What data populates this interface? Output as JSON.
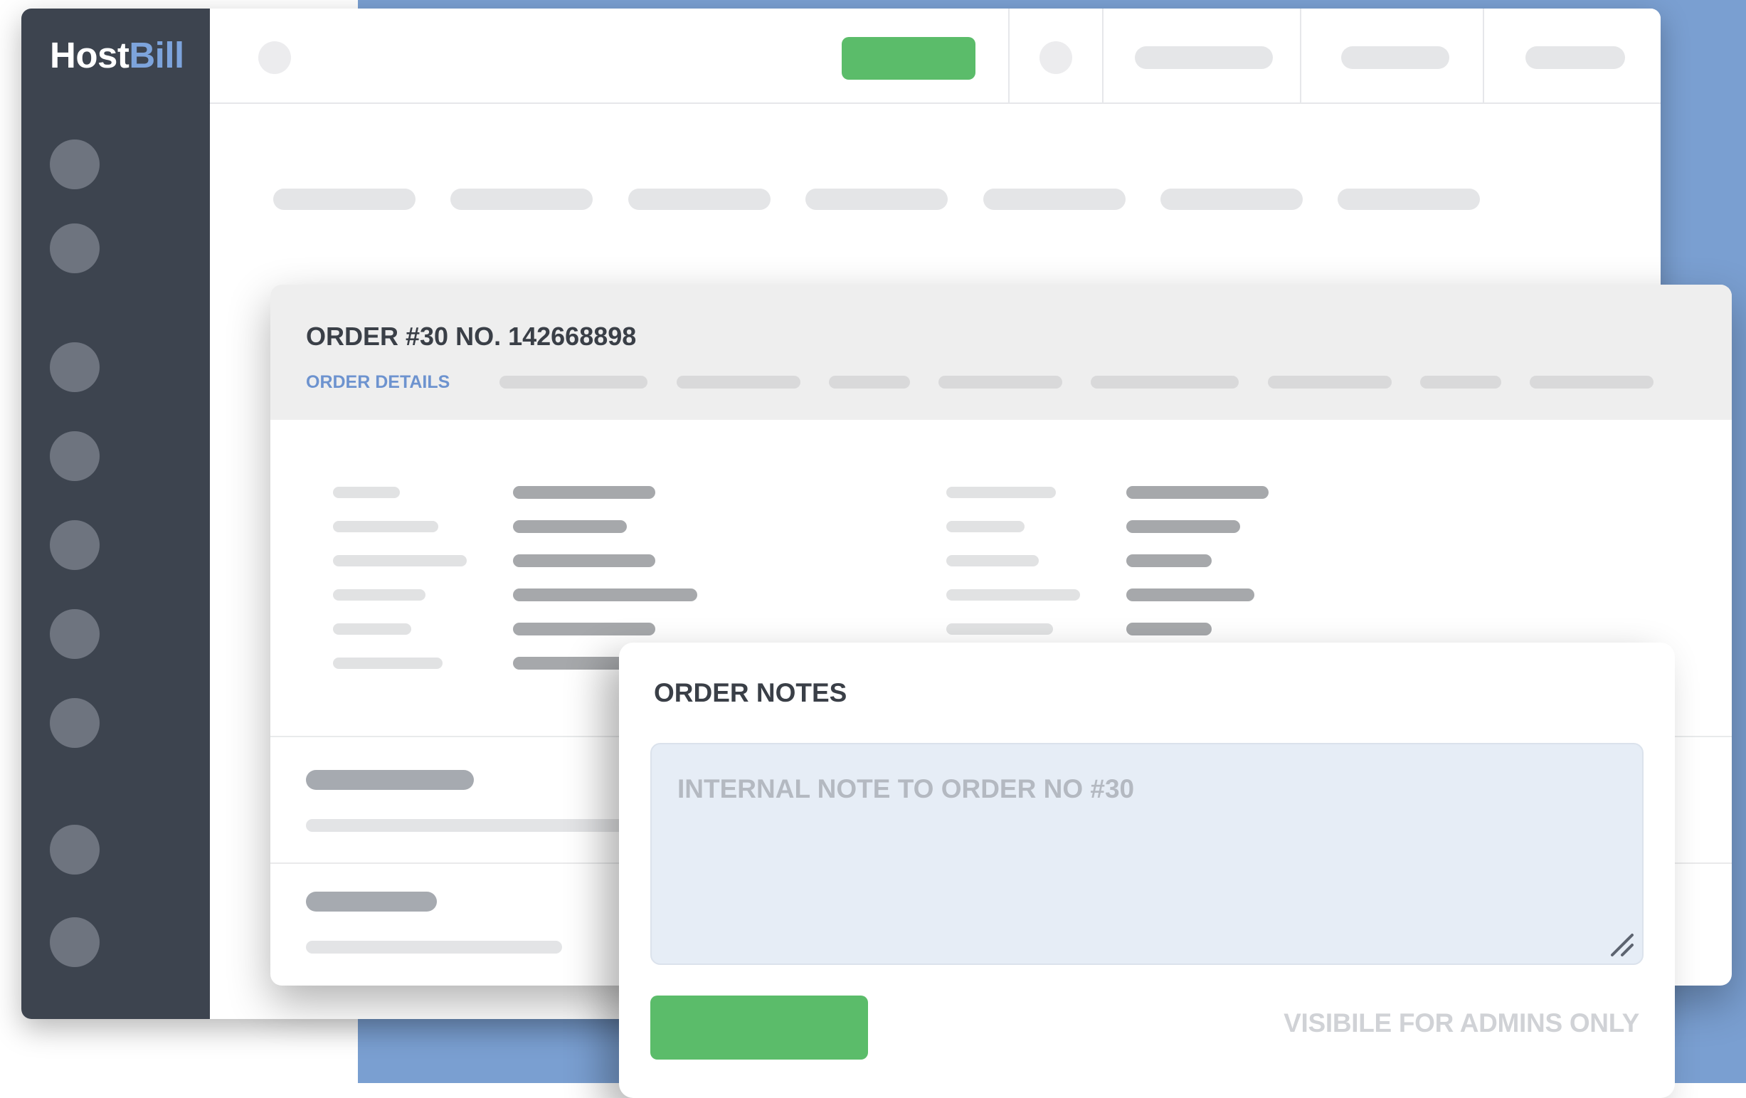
{
  "app": {
    "logo_part1": "Host",
    "logo_part2": "Bill"
  },
  "colors": {
    "accent_green": "#5bbc6a",
    "brand_blue": "#7da4dc",
    "sidebar": "#3d444f",
    "backdrop_blue": "#7a9fd1"
  },
  "order_panel": {
    "title": "ORDER #30 NO. 142668898",
    "active_tab": "ORDER DETAILS"
  },
  "notes_modal": {
    "title": "ORDER NOTES",
    "textarea_placeholder": "INTERNAL NOTE TO ORDER NO #30",
    "textarea_value": "",
    "visibility_note": "VISIBILE FOR ADMINS ONLY",
    "save_button_label": ""
  }
}
